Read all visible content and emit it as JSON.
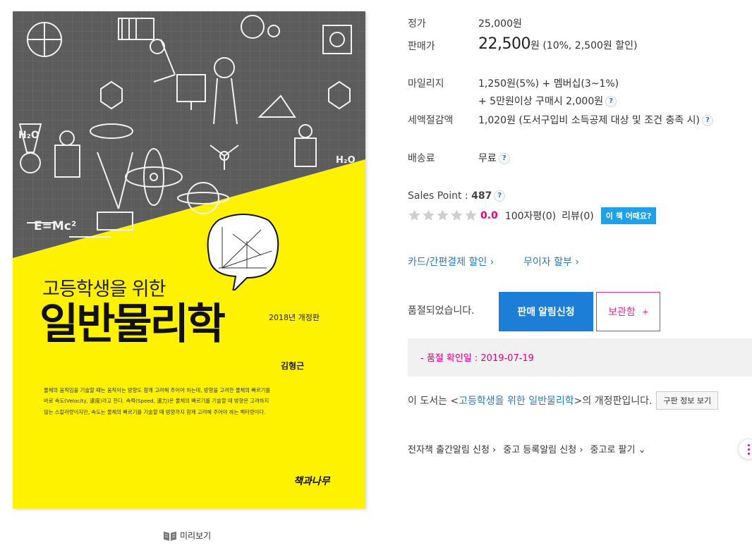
{
  "cover": {
    "subtitle": "고등학생을 위한",
    "title": "일반물리학",
    "edition": "2018년 개정판",
    "author": "김형근",
    "formula": "E=Mc²",
    "h2o": "H₂O",
    "blurb_lines": [
      "물체의 움직임을 기술할 때는 움직이는 방향도 함께 고려해 주어야 하는데, 방향을 고려한 물체의 빠르기를",
      "바로 속도(Velocity, 速度)라고 한다. 속력(Speed, 速力)은 물체의 빠르기를 기술할 때 방향은 고려하지",
      "않는 스칼라량이지만, 속도는 물체의 빠르기를 기술할 때 방향까지 함께 고려해 주어야 하는 벡터량이다."
    ],
    "publisher": "책과나무",
    "preview_label": "미리보기",
    "colors": {
      "yellow": "#fff200",
      "gray": "#5f5f5f"
    }
  },
  "price": {
    "list_label": "정가",
    "list_value": "25,000원",
    "sale_label": "판매가",
    "sale_amount": "22,500",
    "sale_unit": "원",
    "sale_discount": "(10%, 2,500원 할인)"
  },
  "mileage": {
    "label": "마일리지",
    "line1": "1,250원(5%) + 멤버십(3~1%)",
    "line2": "+ 5만원이상 구매시 2,000원"
  },
  "tax": {
    "label": "세액절감액",
    "value": "1,020원 (도서구입비 소득공제 대상 및 조건 충족 시)"
  },
  "shipping": {
    "label": "배송료",
    "value": "무료"
  },
  "sales_point": {
    "label": "Sales Point : ",
    "value": "487"
  },
  "rating": {
    "score": "0.0",
    "reviews_100": "100자평(0)",
    "reviews": "리뷰(0)",
    "howabout": "이 책 어때요?",
    "filled_stars": 0,
    "total_stars": 5
  },
  "links": {
    "card_discount": "카드/간편결제 할인",
    "installment": "무이자 할부"
  },
  "soldout": {
    "text": "품절되었습니다.",
    "notify_button": "판매 알림신청",
    "keep_button": "보관함",
    "keep_plus": "+",
    "confirm_date": "- 품절 확인일 : 2019-07-19"
  },
  "revised": {
    "prefix": "이 도서는 <",
    "book": "고등학생을 위한 일반물리학",
    "suffix": ">의 개정판입니다.",
    "old_button": "구판 정보 보기"
  },
  "bottom": {
    "ebook_alert": "전자책 출간알림 신청",
    "used_alert": "중고 등록알림 신청",
    "sell_used": "중고로 팔기"
  },
  "colors": {
    "accent_blue": "#1c7ed6",
    "accent_pink": "#e6007e"
  }
}
